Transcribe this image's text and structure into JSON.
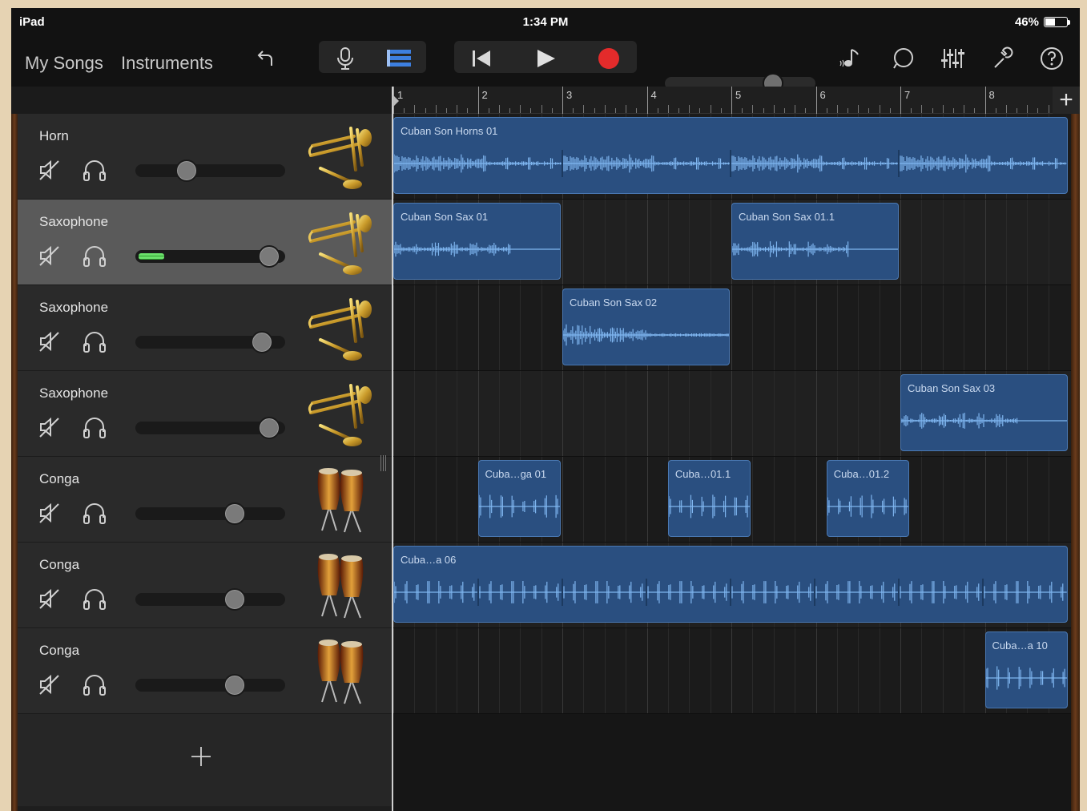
{
  "status": {
    "device": "iPad",
    "time": "1:34 PM",
    "battery": "46%",
    "battery_level": 0.46
  },
  "toolbar": {
    "my_songs": "My Songs",
    "instruments": "Instruments",
    "master_volume": 0.72,
    "icons": [
      "undo-icon",
      "microphone-icon",
      "tracks-view-icon",
      "go-to-beginning-icon",
      "play-icon",
      "record-icon",
      "note-icon",
      "loop-icon",
      "mixer-icon",
      "settings-wrench-icon",
      "help-icon"
    ]
  },
  "ruler": {
    "bars": [
      "1",
      "2",
      "3",
      "4",
      "5",
      "6",
      "7",
      "8"
    ],
    "add": "+"
  },
  "tracks": [
    {
      "name": "Horn",
      "instrument": "brass",
      "volume": 0.33,
      "selected": false,
      "meter": 0
    },
    {
      "name": "Saxophone",
      "instrument": "brass",
      "volume": 0.93,
      "selected": true,
      "meter": 0.2
    },
    {
      "name": "Saxophone",
      "instrument": "brass",
      "volume": 0.88,
      "selected": false,
      "meter": 0
    },
    {
      "name": "Saxophone",
      "instrument": "brass",
      "volume": 0.93,
      "selected": false,
      "meter": 0
    },
    {
      "name": "Conga",
      "instrument": "conga",
      "volume": 0.68,
      "selected": false,
      "meter": 0
    },
    {
      "name": "Conga",
      "instrument": "conga",
      "volume": 0.68,
      "selected": false,
      "meter": 0
    },
    {
      "name": "Conga",
      "instrument": "conga",
      "volume": 0.68,
      "selected": false,
      "meter": 0
    }
  ],
  "regions": [
    [
      {
        "name": "Cuban Son Horns 01",
        "start": 1,
        "end": 9,
        "repeats": 4,
        "style": "horn"
      }
    ],
    [
      {
        "name": "Cuban Son Sax 01",
        "start": 1,
        "end": 3,
        "repeats": 1,
        "style": "sax"
      },
      {
        "name": "Cuban Son Sax 01.1",
        "start": 5,
        "end": 7,
        "repeats": 1,
        "style": "sax"
      }
    ],
    [
      {
        "name": "Cuban Son Sax 02",
        "start": 3,
        "end": 5,
        "repeats": 1,
        "style": "sax2"
      }
    ],
    [
      {
        "name": "Cuban Son Sax 03",
        "start": 7,
        "end": 9,
        "repeats": 1,
        "style": "sax3"
      }
    ],
    [
      {
        "name": "Cuba…ga 01",
        "start": 2,
        "end": 3,
        "repeats": 1,
        "style": "conga"
      },
      {
        "name": "Cuba…01.1",
        "start": 4.25,
        "end": 5.25,
        "repeats": 1,
        "style": "conga"
      },
      {
        "name": "Cuba…01.2",
        "start": 6.125,
        "end": 7.125,
        "repeats": 1,
        "style": "conga"
      }
    ],
    [
      {
        "name": "Cuba…a 06",
        "start": 1,
        "end": 9,
        "repeats": 8,
        "style": "conga"
      }
    ],
    [
      {
        "name": "Cuba…a 10",
        "start": 8,
        "end": 9,
        "repeats": 1,
        "style": "conga"
      }
    ]
  ],
  "add_track": "+"
}
